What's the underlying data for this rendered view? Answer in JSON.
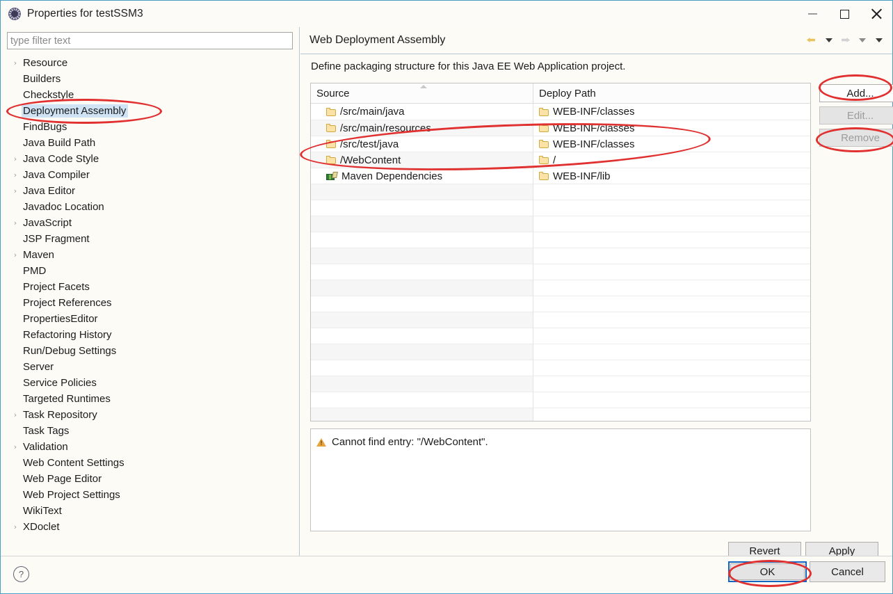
{
  "window": {
    "title": "Properties for testSSM3",
    "icon": "eclipse-gear-icon",
    "controls": {
      "minimize": "–",
      "maximize": "▢",
      "close": "✕"
    }
  },
  "filter": {
    "placeholder": "type filter text",
    "value": ""
  },
  "sidebar": {
    "items": [
      {
        "label": "Resource",
        "expandable": true,
        "selected": false
      },
      {
        "label": "Builders",
        "expandable": false,
        "selected": false
      },
      {
        "label": "Checkstyle",
        "expandable": false,
        "selected": false
      },
      {
        "label": "Deployment Assembly",
        "expandable": false,
        "selected": true
      },
      {
        "label": "FindBugs",
        "expandable": false,
        "selected": false
      },
      {
        "label": "Java Build Path",
        "expandable": false,
        "selected": false
      },
      {
        "label": "Java Code Style",
        "expandable": true,
        "selected": false
      },
      {
        "label": "Java Compiler",
        "expandable": true,
        "selected": false
      },
      {
        "label": "Java Editor",
        "expandable": true,
        "selected": false
      },
      {
        "label": "Javadoc Location",
        "expandable": false,
        "selected": false
      },
      {
        "label": "JavaScript",
        "expandable": true,
        "selected": false
      },
      {
        "label": "JSP Fragment",
        "expandable": false,
        "selected": false
      },
      {
        "label": "Maven",
        "expandable": true,
        "selected": false
      },
      {
        "label": "PMD",
        "expandable": false,
        "selected": false
      },
      {
        "label": "Project Facets",
        "expandable": false,
        "selected": false
      },
      {
        "label": "Project References",
        "expandable": false,
        "selected": false
      },
      {
        "label": "PropertiesEditor",
        "expandable": false,
        "selected": false
      },
      {
        "label": "Refactoring History",
        "expandable": false,
        "selected": false
      },
      {
        "label": "Run/Debug Settings",
        "expandable": false,
        "selected": false
      },
      {
        "label": "Server",
        "expandable": false,
        "selected": false
      },
      {
        "label": "Service Policies",
        "expandable": false,
        "selected": false
      },
      {
        "label": "Targeted Runtimes",
        "expandable": false,
        "selected": false
      },
      {
        "label": "Task Repository",
        "expandable": true,
        "selected": false
      },
      {
        "label": "Task Tags",
        "expandable": false,
        "selected": false
      },
      {
        "label": "Validation",
        "expandable": true,
        "selected": false
      },
      {
        "label": "Web Content Settings",
        "expandable": false,
        "selected": false
      },
      {
        "label": "Web Page Editor",
        "expandable": false,
        "selected": false
      },
      {
        "label": "Web Project Settings",
        "expandable": false,
        "selected": false
      },
      {
        "label": "WikiText",
        "expandable": false,
        "selected": false
      },
      {
        "label": "XDoclet",
        "expandable": true,
        "selected": false
      }
    ]
  },
  "page": {
    "title": "Web Deployment Assembly",
    "description": "Define packaging structure for this Java EE Web Application project.",
    "nav": {
      "back_icon": "back-arrow-icon",
      "back_enabled": true,
      "back_menu_icon": "chevron-down-icon",
      "forward_icon": "forward-arrow-icon",
      "forward_enabled": false,
      "forward_menu_icon": "chevron-down-icon",
      "overflow_menu_icon": "chevron-down-icon"
    }
  },
  "table": {
    "columns": [
      "Source",
      "Deploy Path"
    ],
    "sort_column": "Source",
    "sort_direction": "ascending",
    "rows": [
      {
        "source": "/src/main/java",
        "source_icon": "folder-icon",
        "deploy": "WEB-INF/classes",
        "deploy_icon": "folder-icon"
      },
      {
        "source": "/src/main/resources",
        "source_icon": "folder-icon",
        "deploy": "WEB-INF/classes",
        "deploy_icon": "folder-icon"
      },
      {
        "source": "/src/test/java",
        "source_icon": "folder-icon",
        "deploy": "WEB-INF/classes",
        "deploy_icon": "folder-icon"
      },
      {
        "source": "/WebContent",
        "source_icon": "folder-icon",
        "deploy": "/",
        "deploy_icon": "folder-icon"
      },
      {
        "source": "Maven Dependencies",
        "source_icon": "maven-dependencies-icon",
        "deploy": "WEB-INF/lib",
        "deploy_icon": "folder-icon"
      }
    ],
    "empty_row_count": 16
  },
  "side_buttons": [
    {
      "label": "Add...",
      "mnemonic": "d",
      "enabled": true
    },
    {
      "label": "Edit...",
      "mnemonic": "E",
      "enabled": false
    },
    {
      "label": "Remove",
      "mnemonic": "R",
      "enabled": false
    }
  ],
  "validation": {
    "icon": "warning-icon",
    "severity": "warning",
    "message": "Cannot find entry: \"/WebContent\"."
  },
  "form_buttons": {
    "revert": "Revert",
    "apply": "Apply"
  },
  "dialog_buttons": {
    "help_icon": "help-icon",
    "help_label": "?",
    "ok": "OK",
    "ok_focused": true,
    "cancel": "Cancel"
  },
  "annotations": {
    "color": "#e03030",
    "shapes": [
      {
        "name": "sidebar-deployment-assembly",
        "type": "ellipse"
      },
      {
        "name": "table-rows-test-java-webcontent",
        "type": "ellipse"
      },
      {
        "name": "add-button",
        "type": "ellipse"
      },
      {
        "name": "remove-button",
        "type": "ellipse"
      },
      {
        "name": "ok-button",
        "type": "ellipse"
      }
    ]
  }
}
